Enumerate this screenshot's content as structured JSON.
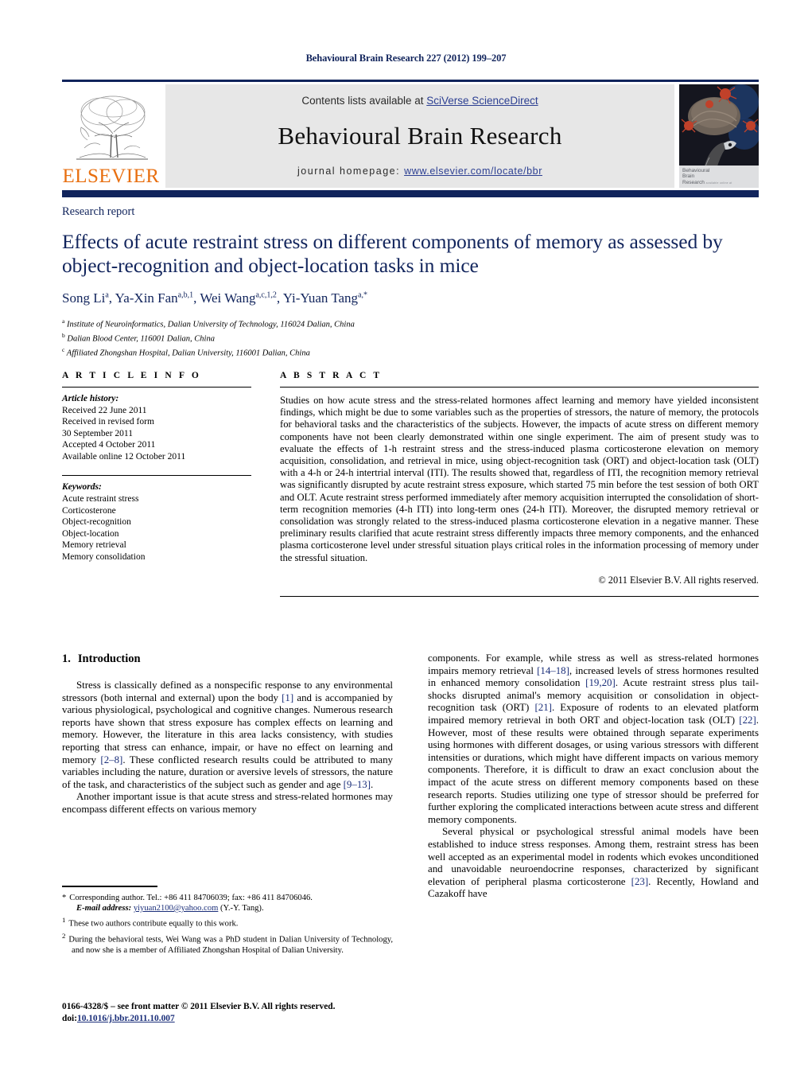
{
  "running_head": "Behavioural Brain Research 227 (2012) 199–207",
  "masthead": {
    "contents_prefix": "Contents lists available at ",
    "contents_link": "SciVerse ScienceDirect",
    "journal_title": "Behavioural Brain Research",
    "homepage_prefix": "journal homepage:",
    "homepage_url": "www.elsevier.com/locate/bbr",
    "publisher_logo_text": "ELSEVIER",
    "cover_caption_line1": "Behavioural",
    "cover_caption_line2": "Brain",
    "cover_caption_line3": "Research",
    "cover_caption_tiny": "available online at www.sciencedirect.com",
    "rule_color": "#11245c",
    "panel_bg": "#e7e7e7",
    "link_color": "#2c3f92",
    "elsevier_orange": "#e86f10"
  },
  "title_block": {
    "section_kind": "Research report",
    "title": "Effects of acute restraint stress on different components of memory as assessed by object-recognition and object-location tasks in mice",
    "authors_html": "Song Li<sup>a</sup>, Ya-Xin Fan<sup>a,b,1</sup>, Wei Wang<sup>a,c,1,2</sup>, Yi-Yuan Tang<sup>a,</sup><sup>*</sup>",
    "affiliations": [
      {
        "marker": "a",
        "text": "Institute of Neuroinformatics, Dalian University of Technology, 116024 Dalian, China"
      },
      {
        "marker": "b",
        "text": "Dalian Blood Center, 116001 Dalian, China"
      },
      {
        "marker": "c",
        "text": "Affiliated Zhongshan Hospital, Dalian University, 116001 Dalian, China"
      }
    ]
  },
  "article_info": {
    "heading": "A R T I C L E    I N F O",
    "history_label": "Article history:",
    "history": [
      "Received 22 June 2011",
      "Received in revised form",
      "30 September 2011",
      "Accepted 4 October 2011",
      "Available online 12 October 2011"
    ],
    "keywords_label": "Keywords:",
    "keywords": [
      "Acute restraint stress",
      "Corticosterone",
      "Object-recognition",
      "Object-location",
      "Memory retrieval",
      "Memory consolidation"
    ]
  },
  "abstract": {
    "heading": "A B S T R A C T",
    "text": "Studies on how acute stress and the stress-related hormones affect learning and memory have yielded inconsistent findings, which might be due to some variables such as the properties of stressors, the nature of memory, the protocols for behavioral tasks and the characteristics of the subjects. However, the impacts of acute stress on different memory components have not been clearly demonstrated within one single experiment. The aim of present study was to evaluate the effects of 1-h restraint stress and the stress-induced plasma corticosterone elevation on memory acquisition, consolidation, and retrieval in mice, using object-recognition task (ORT) and object-location task (OLT) with a 4-h or 24-h intertrial interval (ITI). The results showed that, regardless of ITI, the recognition memory retrieval was significantly disrupted by acute restraint stress exposure, which started 75 min before the test session of both ORT and OLT. Acute restraint stress performed immediately after memory acquisition interrupted the consolidation of short-term recognition memories (4-h ITI) into long-term ones (24-h ITI). Moreover, the disrupted memory retrieval or consolidation was strongly related to the stress-induced plasma corticosterone elevation in a negative manner. These preliminary results clarified that acute restraint stress differently impacts three memory components, and the enhanced plasma corticosterone level under stressful situation plays critical roles in the information processing of memory under the stressful situation.",
    "copyright": "© 2011 Elsevier B.V. All rights reserved."
  },
  "body": {
    "intro_number": "1.",
    "intro_heading": "Introduction",
    "left_paragraphs": [
      "Stress is classically defined as a nonspecific response to any environmental stressors (both internal and external) upon the body [1] and is accompanied by various physiological, psychological and cognitive changes. Numerous research reports have shown that stress exposure has complex effects on learning and memory. However, the literature in this area lacks consistency, with studies reporting that stress can enhance, impair, or have no effect on learning and memory [2–8]. These conflicted research results could be attributed to many variables including the nature, duration or aversive levels of stressors, the nature of the task, and characteristics of the subject such as gender and age [9–13].",
      "Another important issue is that acute stress and stress-related hormones may encompass different effects on various memory"
    ],
    "right_paragraphs": [
      "components. For example, while stress as well as stress-related hormones impairs memory retrieval [14–18], increased levels of stress hormones resulted in enhanced memory consolidation [19,20]. Acute restraint stress plus tail-shocks disrupted animal's memory acquisition or consolidation in object-recognition task (ORT) [21]. Exposure of rodents to an elevated platform impaired memory retrieval in both ORT and object-location task (OLT) [22]. However, most of these results were obtained through separate experiments using hormones with different dosages, or using various stressors with different intensities or durations, which might have different impacts on various memory components. Therefore, it is difficult to draw an exact conclusion about the impact of the acute stress on different memory components based on these research reports. Studies utilizing one type of stressor should be preferred for further exploring the complicated interactions between acute stress and different memory components.",
      "Several physical or psychological stressful animal models have been established to induce stress responses. Among them, restraint stress has been well accepted as an experimental model in rodents which evokes unconditioned and unavoidable neuroendocrine responses, characterized by significant elevation of peripheral plasma corticosterone [23]. Recently, Howland and Cazakoff have"
    ]
  },
  "footnotes": {
    "corresponding_marker": "*",
    "corresponding_text": "Corresponding author. Tel.: +86 411 84706039; fax: +86 411 84706046.",
    "email_label": "E-mail address:",
    "email_value": "yiyuan2100@yahoo.com",
    "email_suffix": "(Y.-Y. Tang).",
    "note1_marker": "1",
    "note1_text": "These two authors contribute equally to this work.",
    "note2_marker": "2",
    "note2_text": "During the behavioral tests, Wei Wang was a PhD student in Dalian University of Technology, and now she is a member of Affiliated Zhongshan Hospital of Dalian University."
  },
  "imprint": {
    "issn_line": "0166-4328/$ – see front matter © 2011 Elsevier B.V. All rights reserved.",
    "doi_label": "doi:",
    "doi_value": "10.1016/j.bbr.2011.10.007"
  }
}
